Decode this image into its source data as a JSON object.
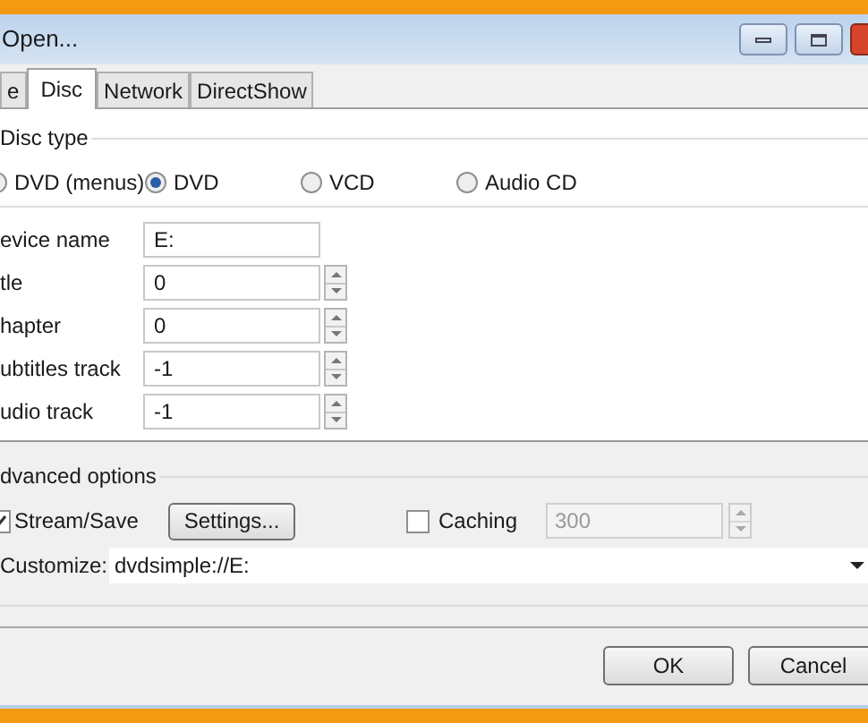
{
  "window": {
    "title": "Open..."
  },
  "tabs": [
    {
      "label": "e",
      "selected": false
    },
    {
      "label": "Disc",
      "selected": true
    },
    {
      "label": "Network",
      "selected": false
    },
    {
      "label": "DirectShow",
      "selected": false
    }
  ],
  "disc_type": {
    "label": "Disc type",
    "options": [
      {
        "label": "DVD (menus)",
        "selected": false
      },
      {
        "label": "DVD",
        "selected": true
      },
      {
        "label": "VCD",
        "selected": false
      },
      {
        "label": "Audio CD",
        "selected": false
      }
    ]
  },
  "fields": [
    {
      "label": "evice name",
      "value": "E:",
      "kind": "text"
    },
    {
      "label": "tle",
      "value": "0",
      "kind": "spin"
    },
    {
      "label": "hapter",
      "value": "0",
      "kind": "spin"
    },
    {
      "label": "ubtitles track",
      "value": "-1",
      "kind": "spin"
    },
    {
      "label": "udio track",
      "value": "-1",
      "kind": "spin"
    }
  ],
  "advanced": {
    "label": "dvanced options",
    "stream_save": {
      "label": "Stream/Save",
      "checked": true
    },
    "settings_button": "Settings...",
    "caching": {
      "label": "Caching",
      "checked": false,
      "value": "300"
    },
    "customize": {
      "label": "Customize:",
      "value": "dvdsimple://E:"
    }
  },
  "buttons": [
    "OK",
    "Cancel"
  ]
}
